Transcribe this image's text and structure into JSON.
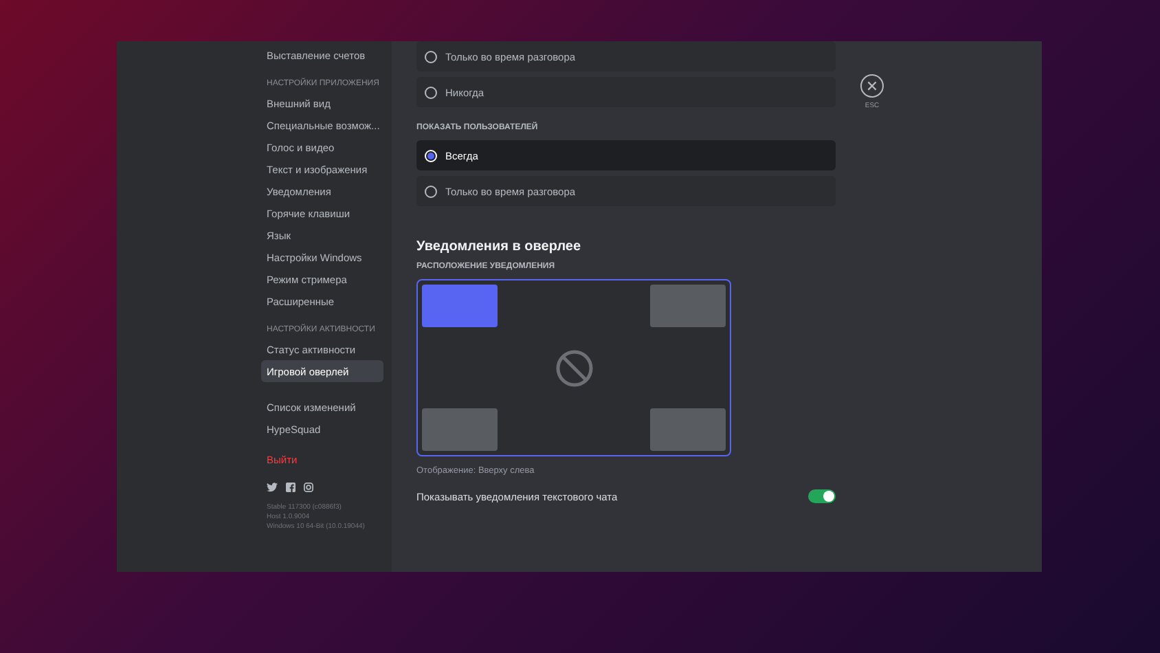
{
  "sidebar": {
    "groups": [
      {
        "items": [
          {
            "label": "Выставление счетов",
            "selected": false
          }
        ]
      },
      {
        "header": "НАСТРОЙКИ ПРИЛОЖЕНИЯ",
        "items": [
          {
            "label": "Внешний вид",
            "selected": false
          },
          {
            "label": "Специальные возмож...",
            "selected": false
          },
          {
            "label": "Голос и видео",
            "selected": false
          },
          {
            "label": "Текст и изображения",
            "selected": false
          },
          {
            "label": "Уведомления",
            "selected": false
          },
          {
            "label": "Горячие клавиши",
            "selected": false
          },
          {
            "label": "Язык",
            "selected": false
          },
          {
            "label": "Настройки Windows",
            "selected": false
          },
          {
            "label": "Режим стримера",
            "selected": false
          },
          {
            "label": "Расширенные",
            "selected": false
          }
        ]
      },
      {
        "header": "НАСТРОЙКИ АКТИВНОСТИ",
        "items": [
          {
            "label": "Статус активности",
            "selected": false
          },
          {
            "label": "Игровой оверлей",
            "selected": true
          }
        ]
      },
      {
        "items": [
          {
            "label": "Список изменений",
            "selected": false
          },
          {
            "label": "HypeSquad",
            "selected": false
          }
        ]
      }
    ],
    "logout": "Выйти",
    "version": [
      "Stable 117300 (c0886f3)",
      "Host 1.0.9004",
      "Windows 10 64-Bit (10.0.19044)"
    ]
  },
  "radio_groups": [
    {
      "options": [
        {
          "label": "Только во время разговора",
          "selected": false
        },
        {
          "label": "Никогда",
          "selected": false
        }
      ]
    },
    {
      "label": "ПОКАЗАТЬ ПОЛЬЗОВАТЕЛЕЙ",
      "options": [
        {
          "label": "Всегда",
          "selected": true
        },
        {
          "label": "Только во время разговора",
          "selected": false
        }
      ]
    }
  ],
  "overlay_notifications": {
    "title": "Уведомления в оверлее",
    "label": "РАСПОЛОЖЕНИЕ УВЕДОМЛЕНИЯ",
    "corners": [
      {
        "selected": true
      },
      {
        "selected": false
      },
      {
        "selected": false
      },
      {
        "selected": false
      }
    ],
    "caption": "Отображение: Вверху слева",
    "toggle": {
      "label": "Показывать уведомления текстового чата",
      "on": true
    }
  },
  "close": {
    "label": "ESC"
  }
}
